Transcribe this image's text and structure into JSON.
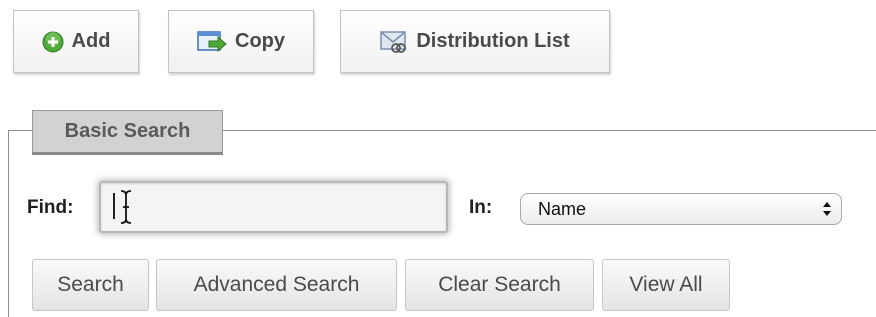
{
  "toolbar": {
    "add_label": "Add",
    "copy_label": "Copy",
    "distribution_label": "Distribution List"
  },
  "basic_search": {
    "legend": "Basic Search",
    "find_label": "Find:",
    "find_value": "",
    "in_label": "In:",
    "in_selected": "Name"
  },
  "buttons": {
    "search": "Search",
    "advanced_search": "Advanced Search",
    "clear_search": "Clear Search",
    "view_all": "View All"
  },
  "icons": {
    "add": "plus-circle-icon",
    "copy": "copy-icon",
    "distribution": "mail-list-icon",
    "select": "select-arrows-icon"
  },
  "colors": {
    "add_icon_green": "#4fa93a",
    "legend_bg": "#d2d2d2",
    "rule": "#8e8e8e"
  }
}
